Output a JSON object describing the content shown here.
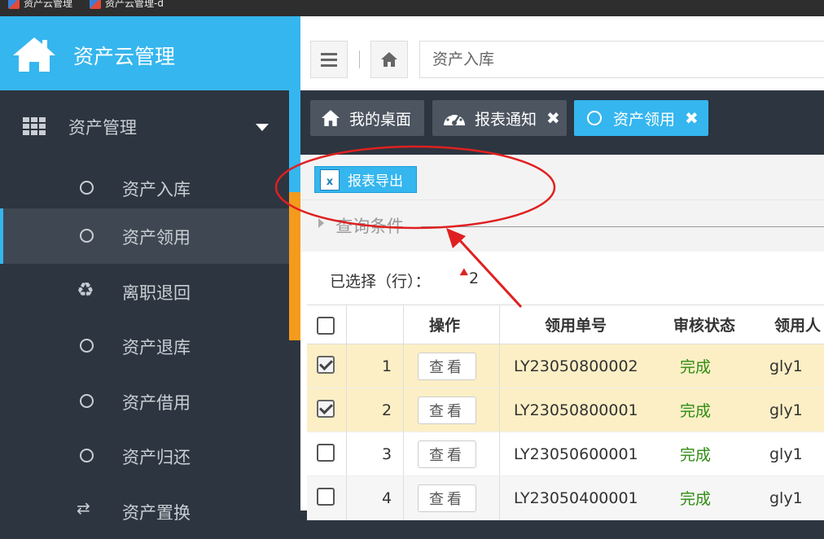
{
  "browser_tabs": [
    {
      "label": "资产云管理"
    },
    {
      "label": "资产云管理-d"
    }
  ],
  "sidebar": {
    "brand": "资产云管理",
    "menu": {
      "label": "资产管理"
    },
    "items": [
      {
        "label": "资产入库",
        "icon": "circle-icon"
      },
      {
        "label": "资产领用",
        "icon": "circle-icon",
        "active": true
      },
      {
        "label": "离职退回",
        "icon": "recycle-icon"
      },
      {
        "label": "资产退库",
        "icon": "circle-icon"
      },
      {
        "label": "资产借用",
        "icon": "circle-icon"
      },
      {
        "label": "资产归还",
        "icon": "circle-icon"
      },
      {
        "label": "资产置换",
        "icon": "exchange-icon"
      }
    ]
  },
  "topbar": {
    "breadcrumb": "资产入库"
  },
  "page_tabs": [
    {
      "label": "我的桌面",
      "icon": "home-icon"
    },
    {
      "label": "报表通知",
      "icon": "dashboard-icon",
      "close": "✖"
    },
    {
      "label": "资产领用",
      "icon": "circle-icon",
      "close": "✖",
      "active": true
    }
  ],
  "toolbar": {
    "export_label": "报表导出",
    "export_icon_letter": "x"
  },
  "query": {
    "label": "查询条件"
  },
  "selection": {
    "label": "已选择（行）：",
    "count": "2"
  },
  "table": {
    "headers": [
      "操作",
      "领用单号",
      "审核状态",
      "领用人"
    ],
    "rows": [
      {
        "index": "1",
        "action": "查看",
        "order_no": "LY23050800002",
        "status": "完成",
        "user": "gly1",
        "checked": true
      },
      {
        "index": "2",
        "action": "查看",
        "order_no": "LY23050800001",
        "status": "完成",
        "user": "gly1",
        "checked": true
      },
      {
        "index": "3",
        "action": "查看",
        "order_no": "LY23050600001",
        "status": "完成",
        "user": "gly1",
        "checked": false
      },
      {
        "index": "4",
        "action": "查看",
        "order_no": "LY23050400001",
        "status": "完成",
        "user": "gly1",
        "checked": false
      }
    ]
  },
  "colors": {
    "accent": "#35b6ee",
    "sidebar_bg": "#2d3540",
    "selected_row": "#fcefc5",
    "status_green": "#2e8b12",
    "annotation_red": "#e02020"
  }
}
